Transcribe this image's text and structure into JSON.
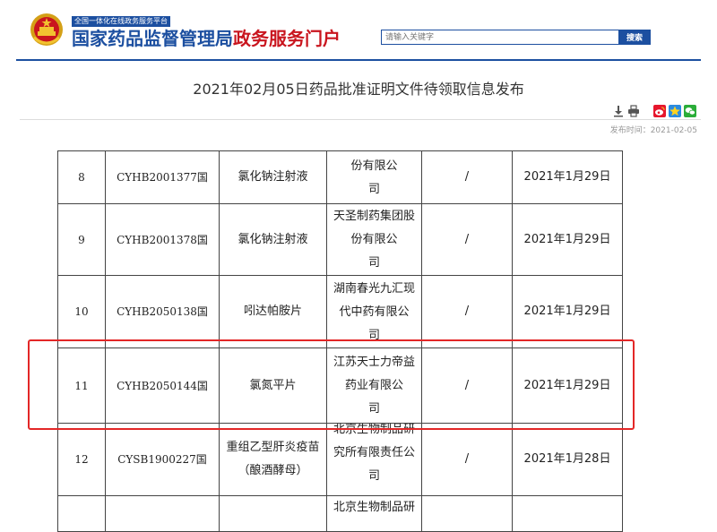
{
  "header": {
    "tagline": "全国一体化在线政务服务平台",
    "brand_main": "国家药品监督管理局",
    "brand_sub": "政务服务门户",
    "search_placeholder": "请输入关键字",
    "search_button": "搜索"
  },
  "article": {
    "title": "2021年02月05日药品批准证明文件待领取信息发布",
    "publish_date": "发布时间：2021-02-05"
  },
  "toolbar": {
    "icons": [
      "download-icon",
      "print-icon",
      "weibo-icon",
      "qzone-icon",
      "wechat-icon"
    ]
  },
  "table": {
    "rows": [
      {
        "no": "8",
        "code": "CYHB2001377国",
        "name": [
          "氯化钠注射液"
        ],
        "company": [
          "",
          "份有限公",
          "司"
        ],
        "status": "/",
        "date": "2021年1月29日"
      },
      {
        "no": "9",
        "code": "CYHB2001378国",
        "name": [
          "氯化钠注射液"
        ],
        "company": [
          "天圣制药集团股",
          "份有限公",
          "司"
        ],
        "status": "/",
        "date": "2021年1月29日"
      },
      {
        "no": "10",
        "code": "CYHB2050138国",
        "name": [
          "吲达帕胺片"
        ],
        "company": [
          "湖南春光九汇现",
          "代中药有限公",
          "司"
        ],
        "status": "/",
        "date": "2021年1月29日"
      },
      {
        "no": "11",
        "code": "CYHB2050144国",
        "name": [
          "氯氮平片"
        ],
        "company": [
          "江苏天士力帝益",
          "药业有限公",
          "司"
        ],
        "status": "/",
        "date": "2021年1月29日"
      },
      {
        "no": "12",
        "code": "CYSB1900227国",
        "name": [
          "重组乙型肝炎疫苗",
          "（酿酒酵母）"
        ],
        "company": [
          "北京生物制品研",
          "究所有限责任公",
          "司"
        ],
        "status": "/",
        "date": "2021年1月28日"
      },
      {
        "no": "",
        "code": "",
        "name": [
          ""
        ],
        "company": [
          "北京生物制品研"
        ],
        "status": "",
        "date": ""
      }
    ]
  },
  "colors": {
    "brand_blue": "#1c4fa0",
    "brand_red": "#c9151e",
    "highlight_red": "#e32727"
  }
}
